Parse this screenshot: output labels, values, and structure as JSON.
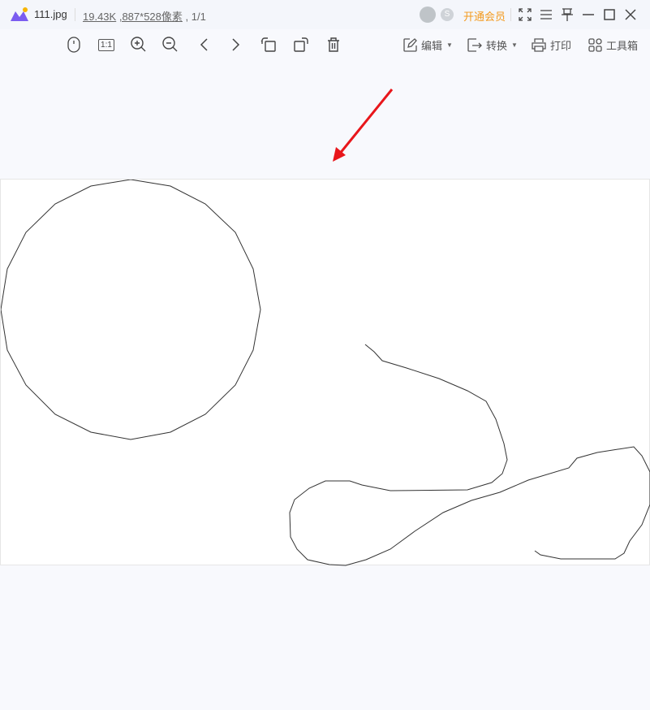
{
  "titlebar": {
    "filename": "111.jpg",
    "filesize": "19.43K",
    "dimensions": ",887*528像素",
    "page": ", 1/1",
    "vip_label": "开通会员"
  },
  "toolbar": {
    "edit_label": "编辑",
    "convert_label": "转换",
    "print_label": "打印",
    "toolbox_label": "工具箱",
    "actual_size": "1:1"
  },
  "colors": {
    "vip": "#f39a1e",
    "arrow": "#e8161b"
  }
}
